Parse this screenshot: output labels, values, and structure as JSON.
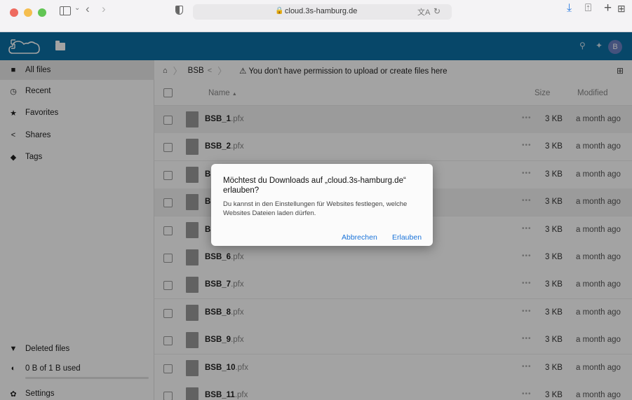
{
  "browser": {
    "url": "cloud.3s-hamburg.de",
    "icons": [
      "sidebar-icon",
      "back-icon",
      "forward-icon",
      "shield-icon",
      "lock-icon",
      "translate-icon",
      "reload-icon",
      "download-icon",
      "share-icon",
      "new-tab-icon",
      "tab-overview-icon"
    ]
  },
  "header": {
    "avatar_initial": "B",
    "accent": "#0b6fa4"
  },
  "sidebar": {
    "items": [
      {
        "label": "All files",
        "icon": "folder-icon"
      },
      {
        "label": "Recent",
        "icon": "clock-icon"
      },
      {
        "label": "Favorites",
        "icon": "star-icon"
      },
      {
        "label": "Shares",
        "icon": "share-icon"
      },
      {
        "label": "Tags",
        "icon": "tag-icon"
      }
    ],
    "deleted_files": "Deleted files",
    "quota": "0 B of 1 B used",
    "quota_fraction": 0.0,
    "settings": "Settings"
  },
  "breadcrumb": {
    "folder": "BSB",
    "warning": "You don't have permission to upload or create files here"
  },
  "table": {
    "col_name": "Name",
    "sort_indicator": "▲",
    "col_size": "Size",
    "col_modified": "Modified",
    "rows": [
      {
        "base": "BSB_1",
        "ext": ".pfx",
        "size": "3 KB",
        "modified": "a month ago"
      },
      {
        "base": "BSB_2",
        "ext": ".pfx",
        "size": "3 KB",
        "modified": "a month ago"
      },
      {
        "base": "B",
        "ext": "",
        "size": "3 KB",
        "modified": "a month ago"
      },
      {
        "base": "B",
        "ext": "",
        "size": "3 KB",
        "modified": "a month ago"
      },
      {
        "base": "B",
        "ext": "",
        "size": "3 KB",
        "modified": "a month ago"
      },
      {
        "base": "BSB_6",
        "ext": ".pfx",
        "size": "3 KB",
        "modified": "a month ago"
      },
      {
        "base": "BSB_7",
        "ext": ".pfx",
        "size": "3 KB",
        "modified": "a month ago"
      },
      {
        "base": "BSB_8",
        "ext": ".pfx",
        "size": "3 KB",
        "modified": "a month ago"
      },
      {
        "base": "BSB_9",
        "ext": ".pfx",
        "size": "3 KB",
        "modified": "a month ago"
      },
      {
        "base": "BSB_10",
        "ext": ".pfx",
        "size": "3 KB",
        "modified": "a month ago"
      },
      {
        "base": "BSB_11",
        "ext": ".pfx",
        "size": "3 KB",
        "modified": "a month ago"
      }
    ]
  },
  "dialog": {
    "title": "Möchtest du Downloads auf „cloud.3s-hamburg.de“ erlauben?",
    "body": "Du kannst in den Einstellungen für Websites festlegen, welche Websites Dateien laden dürfen.",
    "cancel": "Abbrechen",
    "allow": "Erlauben"
  }
}
